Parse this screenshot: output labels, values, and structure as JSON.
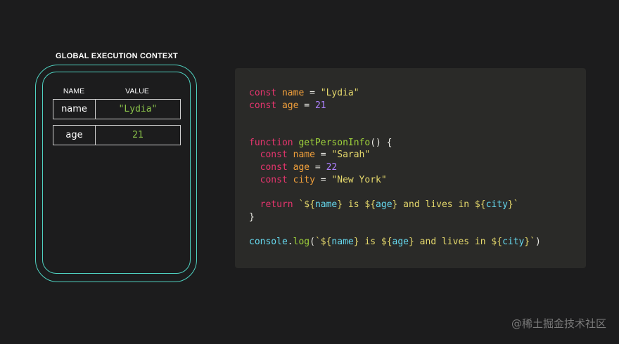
{
  "context": {
    "title": "GLOBAL EXECUTION CONTEXT",
    "col_name": "NAME",
    "col_value": "VALUE",
    "rows": [
      {
        "name": "name",
        "value": "\"Lydia\""
      },
      {
        "name": "age",
        "value": "21"
      }
    ]
  },
  "code_lines": [
    [
      [
        "kw",
        "const "
      ],
      [
        "id",
        "name"
      ],
      [
        "pl",
        " = "
      ],
      [
        "str",
        "\"Lydia\""
      ]
    ],
    [
      [
        "kw",
        "const "
      ],
      [
        "id",
        "age"
      ],
      [
        "pl",
        " = "
      ],
      [
        "num",
        "21"
      ]
    ],
    [],
    [],
    [
      [
        "kw",
        "function "
      ],
      [
        "fn",
        "getPersonInfo"
      ],
      [
        "pl",
        "() {"
      ]
    ],
    [
      [
        "pl",
        "  "
      ],
      [
        "kw",
        "const "
      ],
      [
        "id",
        "name"
      ],
      [
        "pl",
        " = "
      ],
      [
        "str",
        "\"Sarah\""
      ]
    ],
    [
      [
        "pl",
        "  "
      ],
      [
        "kw",
        "const "
      ],
      [
        "id",
        "age"
      ],
      [
        "pl",
        " = "
      ],
      [
        "num",
        "22"
      ]
    ],
    [
      [
        "pl",
        "  "
      ],
      [
        "kw",
        "const "
      ],
      [
        "id",
        "city"
      ],
      [
        "pl",
        " = "
      ],
      [
        "str",
        "\"New York\""
      ]
    ],
    [],
    [
      [
        "pl",
        "  "
      ],
      [
        "kw",
        "return "
      ],
      [
        "tk",
        "`${"
      ],
      [
        "tpl",
        "name"
      ],
      [
        "tk",
        "} is ${"
      ],
      [
        "tpl",
        "age"
      ],
      [
        "tk",
        "} and lives in ${"
      ],
      [
        "tpl",
        "city"
      ],
      [
        "tk",
        "}`"
      ]
    ],
    [
      [
        "pl",
        "}"
      ]
    ],
    [],
    [
      [
        "tpl",
        "console"
      ],
      [
        "pl",
        "."
      ],
      [
        "fn",
        "log"
      ],
      [
        "pl",
        "("
      ],
      [
        "tk",
        "`${"
      ],
      [
        "tpl",
        "name"
      ],
      [
        "tk",
        "} is ${"
      ],
      [
        "tpl",
        "age"
      ],
      [
        "tk",
        "} and lives in ${"
      ],
      [
        "tpl",
        "city"
      ],
      [
        "tk",
        "}`"
      ],
      [
        "pl",
        ")"
      ]
    ]
  ],
  "watermark": "@稀土掘金技术社区"
}
